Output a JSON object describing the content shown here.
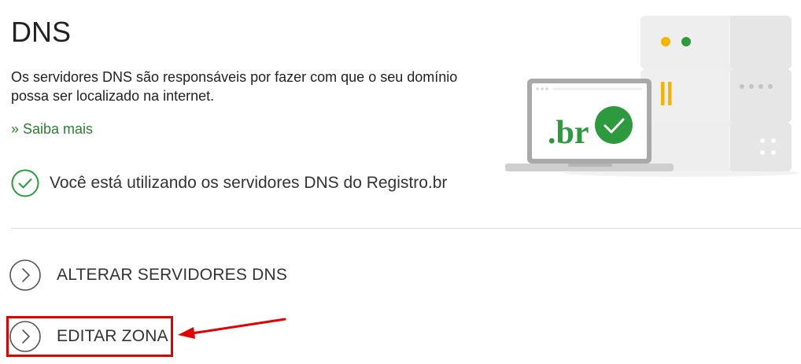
{
  "page": {
    "title": "DNS",
    "description": "Os servidores DNS são responsáveis por fazer com que o seu domínio possa ser localizado na internet.",
    "learn_more": "» Saiba mais",
    "status_text": "Você está utilizando os servidores DNS do Registro.br",
    "illustration_logo_text": ".br"
  },
  "actions": [
    {
      "label": "ALTERAR SERVIDORES DNS"
    },
    {
      "label": "EDITAR ZONA"
    }
  ],
  "colors": {
    "accent_green": "#2e9a3e",
    "link_green": "#2e7d32",
    "highlight_red": "#e00000",
    "server_gray": "#eeeeee",
    "amber": "#f5b400"
  },
  "icons": {
    "status": "check-circle-icon",
    "action": "chevron-right-circle-icon"
  }
}
